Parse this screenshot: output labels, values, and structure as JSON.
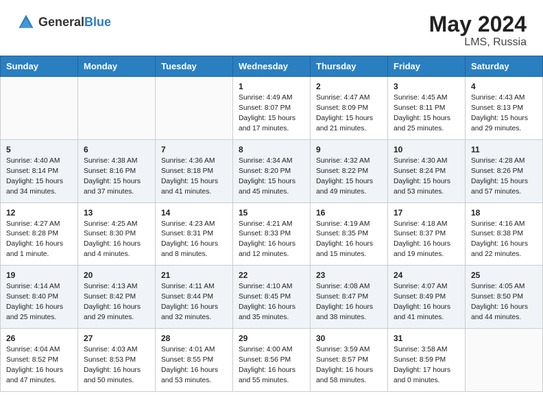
{
  "header": {
    "logo_general": "General",
    "logo_blue": "Blue",
    "title": "May 2024",
    "location": "LMS, Russia"
  },
  "days_of_week": [
    "Sunday",
    "Monday",
    "Tuesday",
    "Wednesday",
    "Thursday",
    "Friday",
    "Saturday"
  ],
  "weeks": [
    [
      {
        "day": "",
        "sunrise": "",
        "sunset": "",
        "daylight": ""
      },
      {
        "day": "",
        "sunrise": "",
        "sunset": "",
        "daylight": ""
      },
      {
        "day": "",
        "sunrise": "",
        "sunset": "",
        "daylight": ""
      },
      {
        "day": "1",
        "sunrise": "Sunrise: 4:49 AM",
        "sunset": "Sunset: 8:07 PM",
        "daylight": "Daylight: 15 hours and 17 minutes."
      },
      {
        "day": "2",
        "sunrise": "Sunrise: 4:47 AM",
        "sunset": "Sunset: 8:09 PM",
        "daylight": "Daylight: 15 hours and 21 minutes."
      },
      {
        "day": "3",
        "sunrise": "Sunrise: 4:45 AM",
        "sunset": "Sunset: 8:11 PM",
        "daylight": "Daylight: 15 hours and 25 minutes."
      },
      {
        "day": "4",
        "sunrise": "Sunrise: 4:43 AM",
        "sunset": "Sunset: 8:13 PM",
        "daylight": "Daylight: 15 hours and 29 minutes."
      }
    ],
    [
      {
        "day": "5",
        "sunrise": "Sunrise: 4:40 AM",
        "sunset": "Sunset: 8:14 PM",
        "daylight": "Daylight: 15 hours and 34 minutes."
      },
      {
        "day": "6",
        "sunrise": "Sunrise: 4:38 AM",
        "sunset": "Sunset: 8:16 PM",
        "daylight": "Daylight: 15 hours and 37 minutes."
      },
      {
        "day": "7",
        "sunrise": "Sunrise: 4:36 AM",
        "sunset": "Sunset: 8:18 PM",
        "daylight": "Daylight: 15 hours and 41 minutes."
      },
      {
        "day": "8",
        "sunrise": "Sunrise: 4:34 AM",
        "sunset": "Sunset: 8:20 PM",
        "daylight": "Daylight: 15 hours and 45 minutes."
      },
      {
        "day": "9",
        "sunrise": "Sunrise: 4:32 AM",
        "sunset": "Sunset: 8:22 PM",
        "daylight": "Daylight: 15 hours and 49 minutes."
      },
      {
        "day": "10",
        "sunrise": "Sunrise: 4:30 AM",
        "sunset": "Sunset: 8:24 PM",
        "daylight": "Daylight: 15 hours and 53 minutes."
      },
      {
        "day": "11",
        "sunrise": "Sunrise: 4:28 AM",
        "sunset": "Sunset: 8:26 PM",
        "daylight": "Daylight: 15 hours and 57 minutes."
      }
    ],
    [
      {
        "day": "12",
        "sunrise": "Sunrise: 4:27 AM",
        "sunset": "Sunset: 8:28 PM",
        "daylight": "Daylight: 16 hours and 1 minute."
      },
      {
        "day": "13",
        "sunrise": "Sunrise: 4:25 AM",
        "sunset": "Sunset: 8:30 PM",
        "daylight": "Daylight: 16 hours and 4 minutes."
      },
      {
        "day": "14",
        "sunrise": "Sunrise: 4:23 AM",
        "sunset": "Sunset: 8:31 PM",
        "daylight": "Daylight: 16 hours and 8 minutes."
      },
      {
        "day": "15",
        "sunrise": "Sunrise: 4:21 AM",
        "sunset": "Sunset: 8:33 PM",
        "daylight": "Daylight: 16 hours and 12 minutes."
      },
      {
        "day": "16",
        "sunrise": "Sunrise: 4:19 AM",
        "sunset": "Sunset: 8:35 PM",
        "daylight": "Daylight: 16 hours and 15 minutes."
      },
      {
        "day": "17",
        "sunrise": "Sunrise: 4:18 AM",
        "sunset": "Sunset: 8:37 PM",
        "daylight": "Daylight: 16 hours and 19 minutes."
      },
      {
        "day": "18",
        "sunrise": "Sunrise: 4:16 AM",
        "sunset": "Sunset: 8:38 PM",
        "daylight": "Daylight: 16 hours and 22 minutes."
      }
    ],
    [
      {
        "day": "19",
        "sunrise": "Sunrise: 4:14 AM",
        "sunset": "Sunset: 8:40 PM",
        "daylight": "Daylight: 16 hours and 25 minutes."
      },
      {
        "day": "20",
        "sunrise": "Sunrise: 4:13 AM",
        "sunset": "Sunset: 8:42 PM",
        "daylight": "Daylight: 16 hours and 29 minutes."
      },
      {
        "day": "21",
        "sunrise": "Sunrise: 4:11 AM",
        "sunset": "Sunset: 8:44 PM",
        "daylight": "Daylight: 16 hours and 32 minutes."
      },
      {
        "day": "22",
        "sunrise": "Sunrise: 4:10 AM",
        "sunset": "Sunset: 8:45 PM",
        "daylight": "Daylight: 16 hours and 35 minutes."
      },
      {
        "day": "23",
        "sunrise": "Sunrise: 4:08 AM",
        "sunset": "Sunset: 8:47 PM",
        "daylight": "Daylight: 16 hours and 38 minutes."
      },
      {
        "day": "24",
        "sunrise": "Sunrise: 4:07 AM",
        "sunset": "Sunset: 8:49 PM",
        "daylight": "Daylight: 16 hours and 41 minutes."
      },
      {
        "day": "25",
        "sunrise": "Sunrise: 4:05 AM",
        "sunset": "Sunset: 8:50 PM",
        "daylight": "Daylight: 16 hours and 44 minutes."
      }
    ],
    [
      {
        "day": "26",
        "sunrise": "Sunrise: 4:04 AM",
        "sunset": "Sunset: 8:52 PM",
        "daylight": "Daylight: 16 hours and 47 minutes."
      },
      {
        "day": "27",
        "sunrise": "Sunrise: 4:03 AM",
        "sunset": "Sunset: 8:53 PM",
        "daylight": "Daylight: 16 hours and 50 minutes."
      },
      {
        "day": "28",
        "sunrise": "Sunrise: 4:01 AM",
        "sunset": "Sunset: 8:55 PM",
        "daylight": "Daylight: 16 hours and 53 minutes."
      },
      {
        "day": "29",
        "sunrise": "Sunrise: 4:00 AM",
        "sunset": "Sunset: 8:56 PM",
        "daylight": "Daylight: 16 hours and 55 minutes."
      },
      {
        "day": "30",
        "sunrise": "Sunrise: 3:59 AM",
        "sunset": "Sunset: 8:57 PM",
        "daylight": "Daylight: 16 hours and 58 minutes."
      },
      {
        "day": "31",
        "sunrise": "Sunrise: 3:58 AM",
        "sunset": "Sunset: 8:59 PM",
        "daylight": "Daylight: 17 hours and 0 minutes."
      },
      {
        "day": "",
        "sunrise": "",
        "sunset": "",
        "daylight": ""
      }
    ]
  ]
}
